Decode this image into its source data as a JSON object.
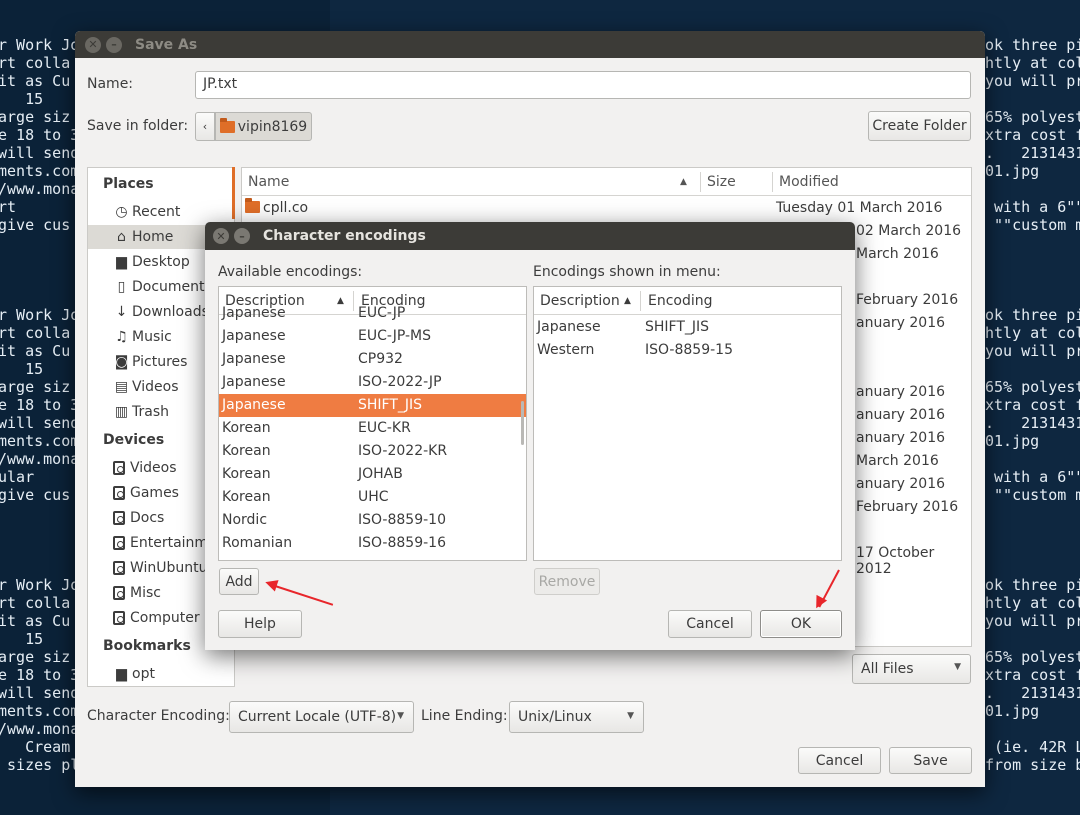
{
  "terminal": {
    "left_lines": [
      "r Work Jo",
      "rt colla",
      "it as Cu",
      "   15",
      "arge siz",
      "e 18 to 3",
      "will send",
      "ments.com",
      "/www.mona",
      "rt",
      "give cus",
      "",
      "",
      "",
      "",
      "r Work Jo",
      "rt colla",
      "it as Cu",
      "   15",
      "arge siz",
      "e 18 to 3",
      "will send",
      "ments.com",
      "/www.mona",
      "ular",
      "give cus",
      "",
      "",
      "",
      "",
      "r Work Jo",
      "rt colla",
      "it as Cu",
      "   15",
      "arge siz",
      "e 18 to 3",
      "will send",
      "ments.com",
      "/www.mona",
      "   Cream",
      " sizes pl"
    ],
    "right_lines": [
      "ok three pi",
      "htly at col",
      "you will pr",
      "",
      "65% polyest",
      "xtra cost f",
      ".   2131431",
      "01.jpg",
      "",
      " with a 6\"\"",
      " \"\"custom m",
      "",
      "",
      "",
      "",
      "ok three pi",
      "htly at col",
      "you will pr",
      "",
      "65% polyest",
      "xtra cost f",
      ".   2131431",
      "01.jpg",
      "",
      " with a 6\"\"",
      " \"\"custom m",
      "",
      "",
      "",
      "",
      "ok three pi",
      "htly at col",
      "you will pr",
      "",
      "65% polyest",
      "xtra cost f",
      ".   2131431",
      "01.jpg",
      "",
      " (ie. 42R L",
      "from size b"
    ]
  },
  "save_as": {
    "title": "Save As",
    "name_label": "Name:",
    "name_value": "JP.txt",
    "folder_label": "Save in folder:",
    "folder_value": "vipin8169",
    "create_folder": "Create Folder",
    "places_heading": "Places",
    "places": [
      "Recent",
      "Home",
      "Desktop",
      "Documents",
      "Downloads",
      "Music",
      "Pictures",
      "Videos",
      "Trash"
    ],
    "devices_heading": "Devices",
    "devices": [
      "Videos",
      "Games",
      "Docs",
      "Entertainm",
      "WinUbuntu",
      "Misc",
      "Computer"
    ],
    "bookmarks_heading": "Bookmarks",
    "bookmarks": [
      "opt"
    ],
    "columns": {
      "name": "Name",
      "size": "Size",
      "modified": "Modified"
    },
    "first_file": {
      "name": "cpll.co",
      "modified": "Tuesday 01 March 2016"
    },
    "visible_dates": [
      "02 March 2016",
      "March 2016",
      "February 2016",
      "anuary 2016",
      "anuary 2016",
      "anuary 2016",
      "anuary 2016",
      "March 2016",
      "anuary 2016",
      "February 2016",
      "17 October 2012"
    ],
    "filter_value": "All Files",
    "encoding_label": "Character Encoding:",
    "encoding_value": "Current Locale (UTF-8)",
    "line_ending_label": "Line Ending:",
    "line_ending_value": "Unix/Linux",
    "cancel": "Cancel",
    "save": "Save"
  },
  "encodings_dialog": {
    "title": "Character encodings",
    "available_label": "Available encodings:",
    "shown_label": "Encodings shown in menu:",
    "col_description": "Description",
    "col_encoding": "Encoding",
    "available": [
      {
        "description": "Japanese",
        "encoding": "EUC-JP"
      },
      {
        "description": "Japanese",
        "encoding": "EUC-JP-MS"
      },
      {
        "description": "Japanese",
        "encoding": "CP932"
      },
      {
        "description": "Japanese",
        "encoding": "ISO-2022-JP"
      },
      {
        "description": "Japanese",
        "encoding": "SHIFT_JIS",
        "selected": true
      },
      {
        "description": "Korean",
        "encoding": "EUC-KR"
      },
      {
        "description": "Korean",
        "encoding": "ISO-2022-KR"
      },
      {
        "description": "Korean",
        "encoding": "JOHAB"
      },
      {
        "description": "Korean",
        "encoding": "UHC"
      },
      {
        "description": "Nordic",
        "encoding": "ISO-8859-10"
      },
      {
        "description": "Romanian",
        "encoding": "ISO-8859-16"
      }
    ],
    "shown": [
      {
        "description": "Japanese",
        "encoding": "SHIFT_JIS"
      },
      {
        "description": "Western",
        "encoding": "ISO-8859-15"
      }
    ],
    "add": "Add",
    "remove": "Remove",
    "help": "Help",
    "cancel": "Cancel",
    "ok": "OK"
  },
  "colors": {
    "accent": "#ef7c42",
    "titlebar": "#3c3b37",
    "annotation_arrow": "#e8262b"
  }
}
